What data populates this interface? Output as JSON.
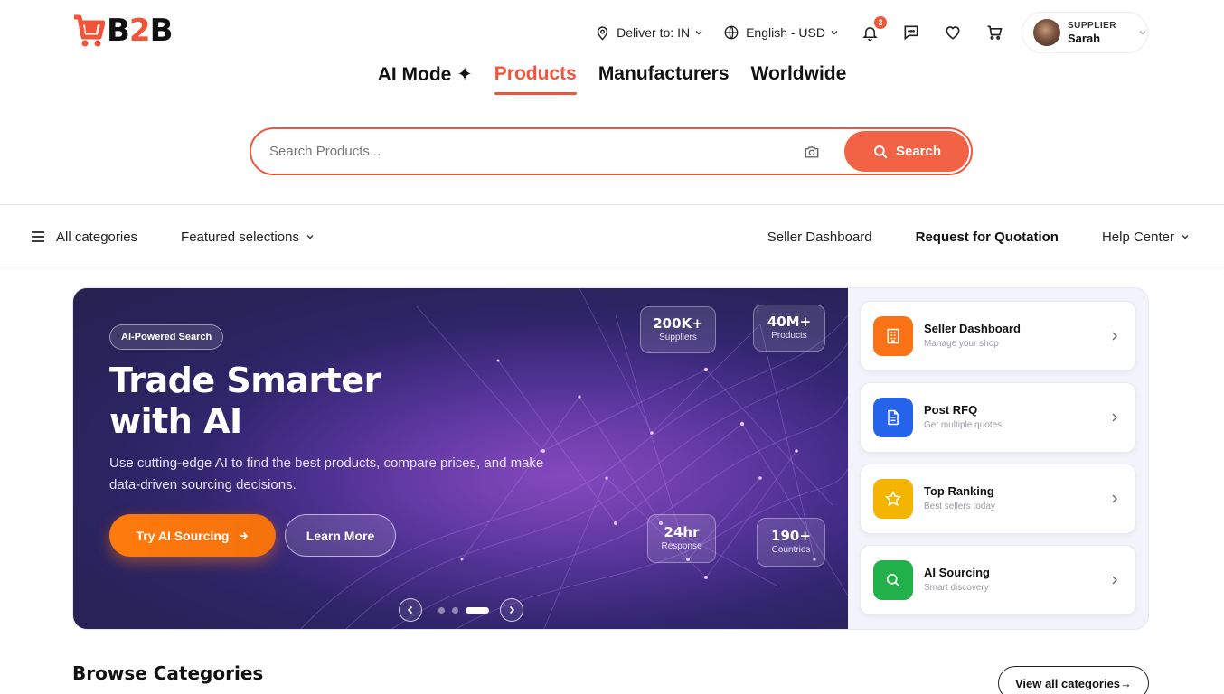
{
  "logo": {
    "text_b": "B",
    "text_2": "2",
    "text_b2": "B"
  },
  "utility": {
    "deliver_label": "Deliver to: IN",
    "language_label": "English - USD",
    "notification_count": "3",
    "profile_role": "SUPPLIER",
    "profile_name": "Sarah"
  },
  "mode_tabs": [
    {
      "label": "AI Mode ✦",
      "active": false
    },
    {
      "label": "Products",
      "active": true
    },
    {
      "label": "Manufacturers",
      "active": false
    },
    {
      "label": "Worldwide",
      "active": false
    }
  ],
  "search": {
    "placeholder": "Search Products...",
    "value": "",
    "button_label": "Search"
  },
  "navbar": {
    "all_categories": "All categories",
    "featured": "Featured selections",
    "seller_dashboard": "Seller Dashboard",
    "rfq": "Request for Quotation",
    "help_center": "Help Center"
  },
  "hero": {
    "tag": "AI-Powered Search",
    "title_line1": "Trade Smarter",
    "title_line2": "with AI",
    "description": "Use cutting-edge AI to find the best products, compare prices, and make data-driven sourcing decisions.",
    "cta_primary": "Try AI Sourcing",
    "cta_secondary": "Learn More",
    "stats": [
      {
        "value": "200K+",
        "label": "Suppliers"
      },
      {
        "value": "40M+",
        "label": "Products"
      },
      {
        "value": "24hr",
        "label": "Response"
      },
      {
        "value": "190+",
        "label": "Countries"
      }
    ],
    "carousel": {
      "slide_count": 3,
      "active_index": 2
    }
  },
  "quick_links": [
    {
      "title": "Seller Dashboard",
      "subtitle": "Manage your shop",
      "icon": "building-icon",
      "color": "#f97316"
    },
    {
      "title": "Post RFQ",
      "subtitle": "Get multiple quotes",
      "icon": "document-icon",
      "color": "#2563eb"
    },
    {
      "title": "Top Ranking",
      "subtitle": "Best sellers today",
      "icon": "star-icon",
      "color": "#f5b400"
    },
    {
      "title": "AI Sourcing",
      "subtitle": "Smart discovery",
      "icon": "search-icon",
      "color": "#22b04b"
    }
  ],
  "browse": {
    "title": "Browse Categories",
    "view_all": "View all categories→"
  },
  "colors": {
    "accent": "#f0553a",
    "cta_orange": "#ff7b0d",
    "banner_purple": "#3f2a86"
  }
}
